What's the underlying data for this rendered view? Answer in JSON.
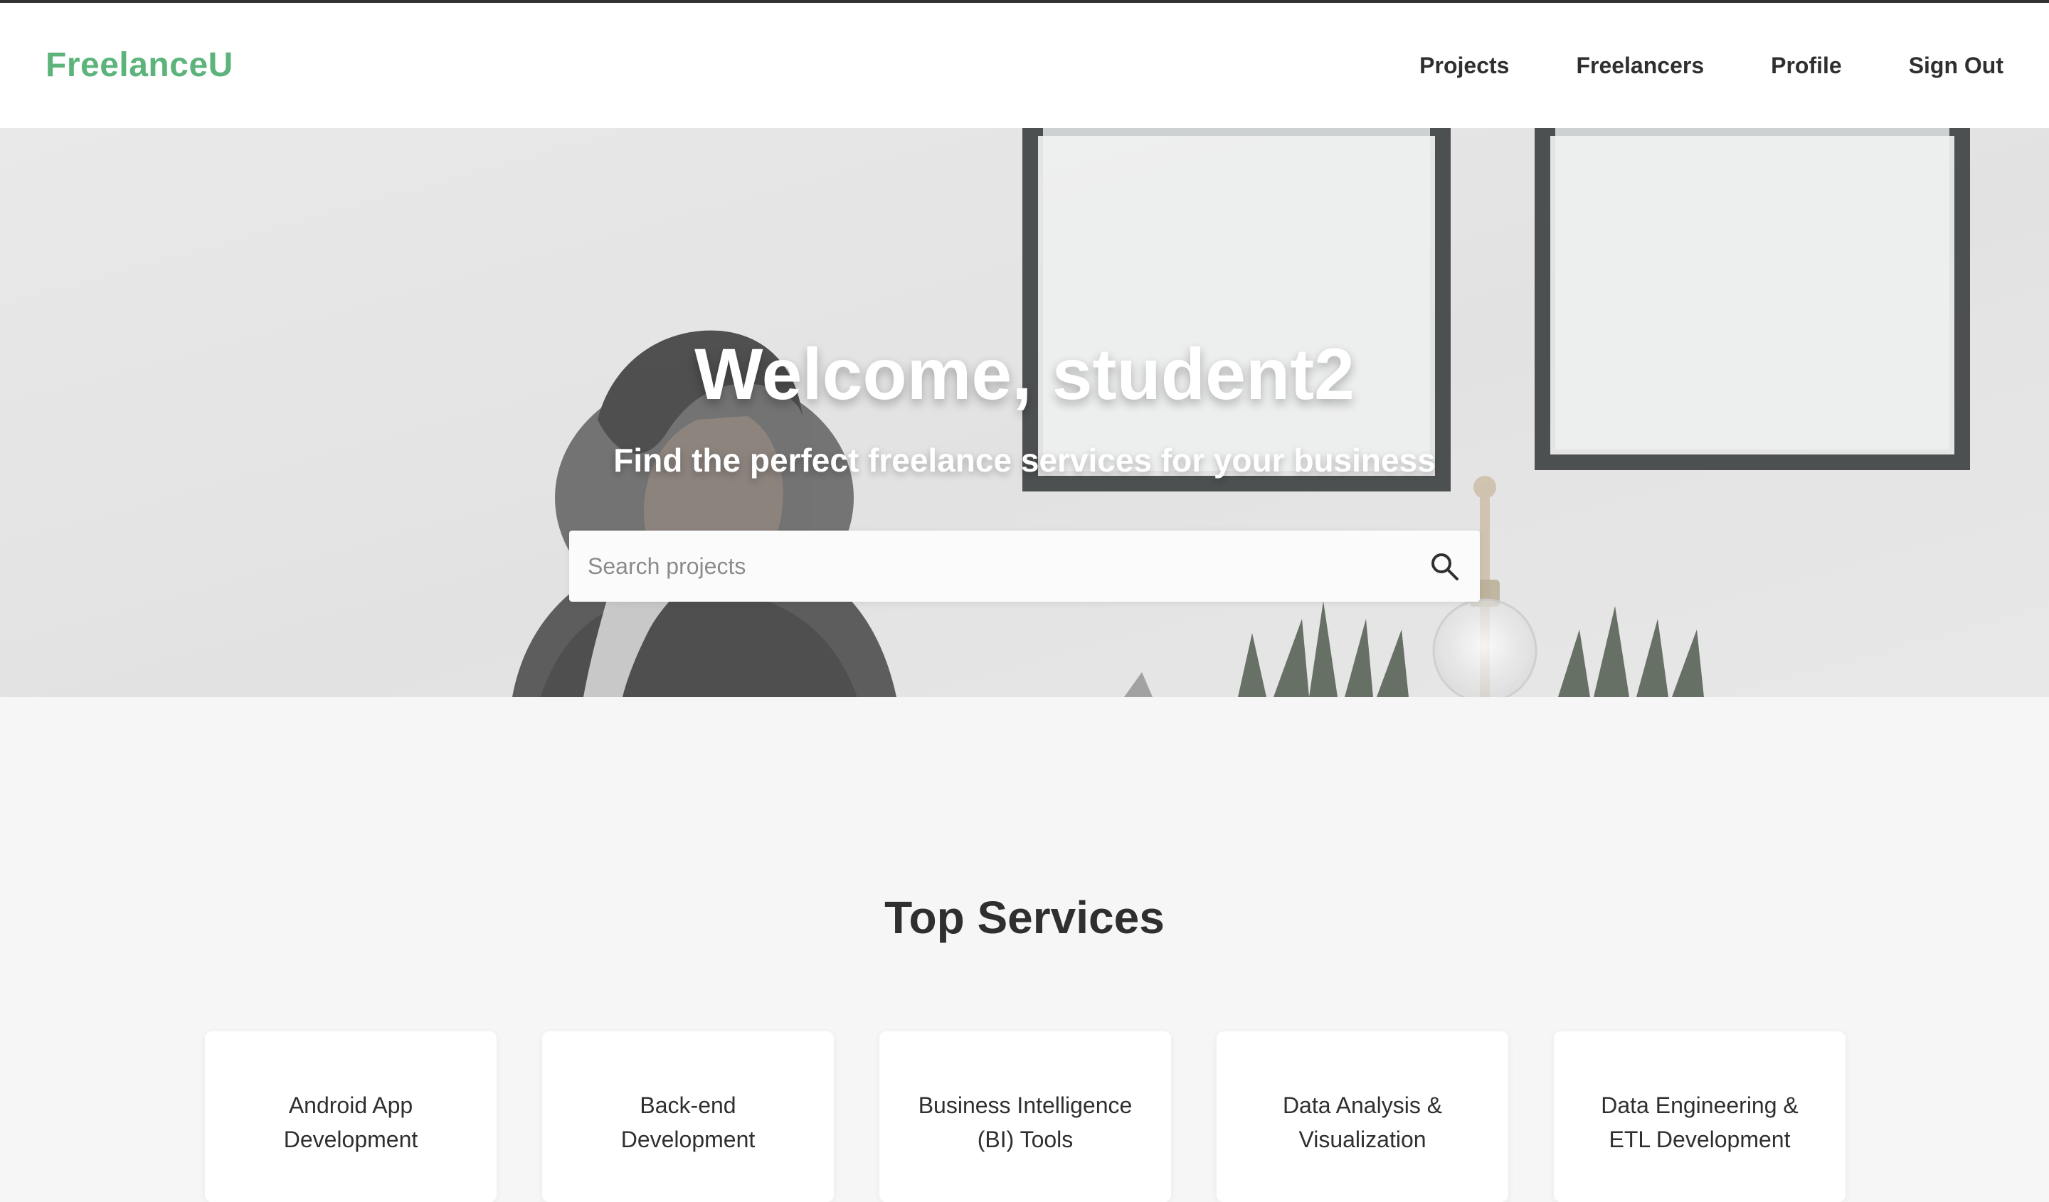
{
  "header": {
    "brand": "FreelanceU",
    "nav": [
      {
        "label": "Projects"
      },
      {
        "label": "Freelancers"
      },
      {
        "label": "Profile"
      },
      {
        "label": "Sign Out"
      }
    ]
  },
  "hero": {
    "title": "Welcome, student2",
    "subtitle": "Find the perfect freelance services for your business",
    "search": {
      "placeholder": "Search projects",
      "value": "",
      "icon": "search-icon"
    }
  },
  "services": {
    "title": "Top Services",
    "items": [
      {
        "label": "Android App\nDevelopment"
      },
      {
        "label": "Back-end\nDevelopment"
      },
      {
        "label": "Business Intelligence\n(BI) Tools"
      },
      {
        "label": "Data Analysis &\nVisualization"
      },
      {
        "label": "Data Engineering &\nETL Development"
      }
    ]
  },
  "colors": {
    "brand": "#5cb47b",
    "text": "#2f2f2f",
    "background": "#f6f6f6"
  }
}
